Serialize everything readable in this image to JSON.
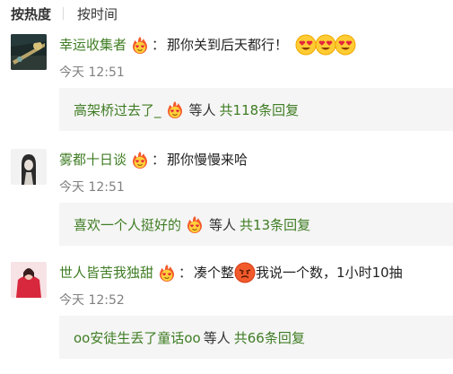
{
  "sort_bar": {
    "hot_label": "按热度",
    "time_label": "按时间"
  },
  "comments": [
    {
      "user": "幸运收集者",
      "badge_icon": "heart-eyes-flame-icon",
      "colon": "：",
      "text": "那你关到后天都行！",
      "time": "今天 12:51",
      "emojis": [
        "heart-eyes-emoji",
        "heart-eyes-emoji",
        "heart-eyes-emoji"
      ],
      "reply": {
        "user": "高架桥过去了_",
        "middle": "等人",
        "count": "共118条回复"
      }
    },
    {
      "user": "雾都十日谈",
      "badge_icon": "heart-eyes-flame-icon",
      "colon": "：",
      "text": "那你慢慢来哈",
      "time": "今天 12:51",
      "emojis": [],
      "reply": {
        "user": "喜欢一个人挺好的",
        "middle": "等人",
        "count": "共13条回复"
      }
    },
    {
      "user": "世人皆苦我独甜",
      "badge_icon": "heart-eyes-flame-icon",
      "colon": "：",
      "text_before": "凑个整",
      "text_after": "我说一个数，1小时10抽",
      "inline_emoji": "angry-emoji",
      "time": "今天 12:52",
      "reply": {
        "user": "oo安徒生丢了童话oo",
        "middle": "等人",
        "count": "共66条回复"
      }
    }
  ],
  "colors": {
    "username": "#3f7d24",
    "text": "#222222",
    "timestamp": "#808080",
    "reply_bg": "#f5f5f5"
  }
}
